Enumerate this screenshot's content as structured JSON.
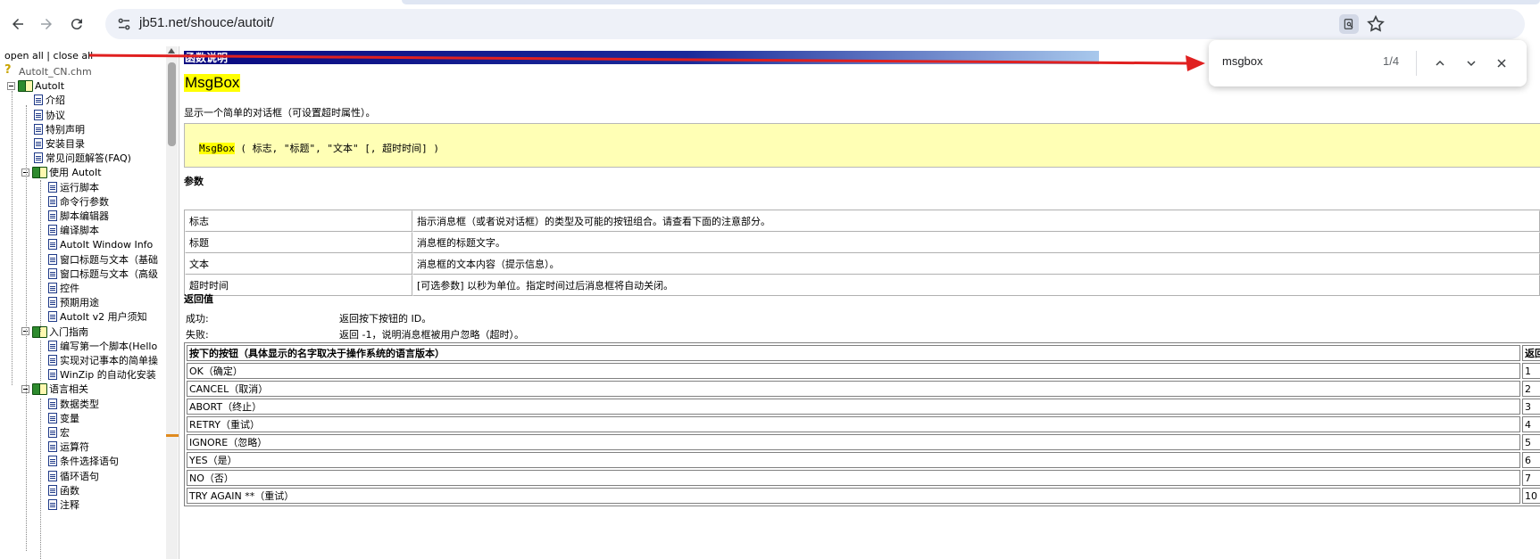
{
  "browser": {
    "url": "jb51.net/shouce/autoit/",
    "icons": [
      "back-icon",
      "forward-icon",
      "reload-icon",
      "site-info-icon",
      "extension-icon",
      "bookmark-star-icon"
    ]
  },
  "find": {
    "query": "msgbox",
    "count": "1/4",
    "icons": [
      "chevron-up-icon",
      "chevron-down-icon",
      "close-icon"
    ]
  },
  "tree": {
    "open_all": "open all",
    "sep": " | ",
    "close_all": "close all",
    "root": "AutoIt_CN.chm",
    "autoit": "AutoIt",
    "top_items": [
      "介绍",
      "协议",
      "特别声明",
      "安装目录",
      "常见问题解答(FAQ)"
    ],
    "use_autoit": "使用 AutoIt",
    "use_items": [
      "运行脚本",
      "命令行参数",
      "脚本编辑器",
      "编译脚本",
      "AutoIt Window Info",
      "窗口标题与文本（基础",
      "窗口标题与文本（高级",
      "控件",
      "预期用途",
      "AutoIt v2 用户须知"
    ],
    "intro": "入门指南",
    "intro_items": [
      "编写第一个脚本(Hello",
      "实现对记事本的简单操",
      "WinZip 的自动化安装"
    ],
    "lang": "语言相关",
    "lang_items": [
      "数据类型",
      "变量",
      "宏",
      "运算符",
      "条件选择语句",
      "循环语句",
      "函数",
      "注释"
    ]
  },
  "doc": {
    "header": "函数说明",
    "title": "MsgBox",
    "description": "显示一个简单的对话框（可设置超时属性）。",
    "syntax_fn": "MsgBox",
    "syntax_rest": " ( 标志, \"标题\", \"文本\" [, 超时时间] )",
    "params_heading": "参数",
    "params": [
      {
        "name": "标志",
        "desc": "指示消息框（或者说对话框）的类型及可能的按钮组合。请查看下面的注意部分。"
      },
      {
        "name": "标题",
        "desc": "消息框的标题文字。"
      },
      {
        "name": "文本",
        "desc": "消息框的文本内容（提示信息）。"
      },
      {
        "name": "超时时间",
        "desc": "[可选参数] 以秒为单位。指定时间过后消息框将自动关闭。"
      }
    ],
    "return_heading": "返回值",
    "success_label": "成功:",
    "success_value": "返回按下按钮的 ID。",
    "fail_label": "失败:",
    "fail_value": "返回 -1，说明消息框被用户忽略（超时）。",
    "buttons_header": "按下的按钮（具体显示的名字取决于操作系统的语言版本）",
    "buttons_header_right": "返回",
    "buttons": [
      {
        "name": "OK（确定）",
        "value": "1"
      },
      {
        "name": "CANCEL（取消）",
        "value": "2"
      },
      {
        "name": "ABORT（终止）",
        "value": "3"
      },
      {
        "name": "RETRY（重试）",
        "value": "4"
      },
      {
        "name": "IGNORE（忽略）",
        "value": "5"
      },
      {
        "name": "YES（是）",
        "value": "6"
      },
      {
        "name": "NO（否）",
        "value": "7"
      },
      {
        "name": "TRY AGAIN **（重试）",
        "value": "10"
      }
    ]
  },
  "colors": {
    "highlight": "#ffff00",
    "syntax_bg": "#ffffb5",
    "header_dark": "#0a0a80",
    "arrow": "#e02020"
  }
}
